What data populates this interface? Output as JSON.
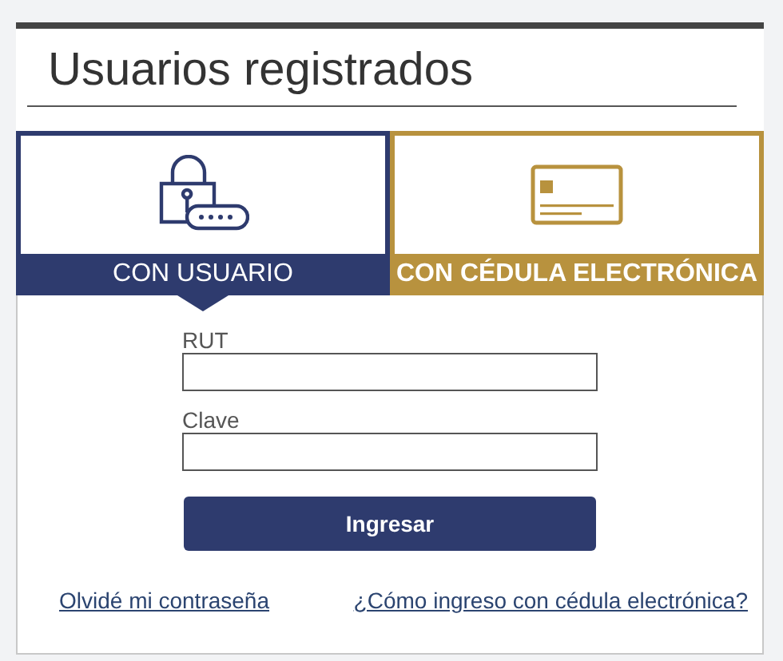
{
  "title": "Usuarios registrados",
  "tabs": [
    {
      "kind": "password",
      "label": "CON USUARIO",
      "selected": true,
      "color": "#2e3b6e"
    },
    {
      "kind": "card",
      "label": "CON CÉDULA ELECTRÓNICA",
      "selected": false,
      "color": "#b8923e"
    }
  ],
  "fields": [
    {
      "label": "RUT"
    },
    {
      "label": "Clave"
    }
  ],
  "submit": "Ingresar",
  "links": [
    "Olvidé mi contraseña",
    "¿Cómo ingreso con cédula electrónica?"
  ]
}
